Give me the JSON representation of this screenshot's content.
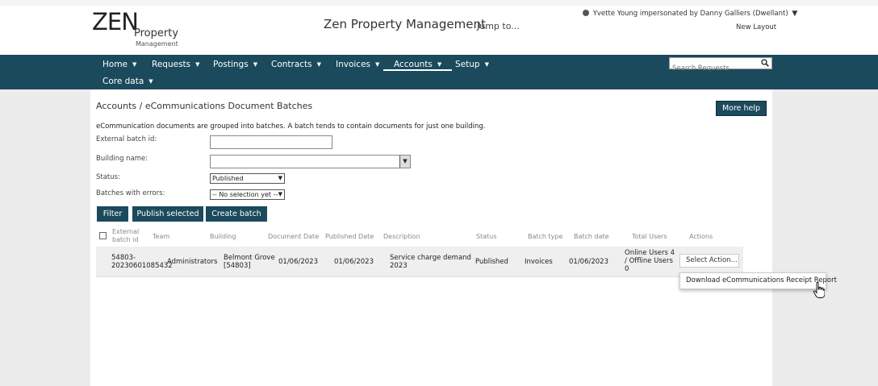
{
  "header": {
    "logo_zen": "ZEN",
    "logo_property": "Property",
    "logo_management": "Management",
    "app_title": "Zen Property Management",
    "jump_to": "Jump to...",
    "user_text": "Yvette Young impersonated by Danny Galliers (Dwellant)",
    "user_caret": "▼",
    "new_layout": "New Layout"
  },
  "nav": {
    "items": [
      {
        "label": "Home"
      },
      {
        "label": "Requests"
      },
      {
        "label": "Postings"
      },
      {
        "label": "Contracts"
      },
      {
        "label": "Invoices"
      },
      {
        "label": "Accounts",
        "active": true
      },
      {
        "label": "Setup"
      },
      {
        "label": "Core data"
      }
    ],
    "caret": "▼",
    "search_placeholder": "Search Requests"
  },
  "page": {
    "breadcrumb": "Accounts / eCommunications Document Batches",
    "more_help": "More help",
    "intro": "eCommunication documents are grouped into batches. A batch tends to contain documents for just one building."
  },
  "filters": {
    "external_batch_label": "External batch id:",
    "external_batch_value": "",
    "building_label": "Building name:",
    "building_value": "",
    "status_label": "Status:",
    "status_value": "Published",
    "errors_label": "Batches with errors:",
    "errors_value": "-- No selection yet --"
  },
  "buttons": {
    "filter": "Filter",
    "publish_selected": "Publish selected",
    "create_batch": "Create batch"
  },
  "table": {
    "headers": {
      "external_batch_id_1": "External",
      "external_batch_id_2": "batch id",
      "team": "Team",
      "building": "Building",
      "document_date": "Document Date",
      "published_date": "Published Date",
      "description": "Description",
      "status": "Status",
      "batch_type": "Batch type",
      "batch_date": "Batch date",
      "total_users": "Total Users",
      "actions": "Actions"
    },
    "rows": [
      {
        "batch_id_1": "54803-",
        "batch_id_2": "20230601085432",
        "team": "Administrators",
        "building_1": "Belmont Grove",
        "building_2": "[54803]",
        "document_date": "01/06/2023",
        "published_date": "01/06/2023",
        "description_1": "Service charge demand",
        "description_2": "2023",
        "status": "Published",
        "batch_type": "Invoices",
        "batch_date": "01/06/2023",
        "users_1": "Online Users 4",
        "users_2": "/ Offline Users",
        "users_3": "0",
        "action_label": "Select Action..."
      }
    ]
  },
  "dropdown": {
    "item": "Download eCommunications Receipt Report"
  },
  "colors": {
    "nav_bg": "#1b4a5c",
    "button_bg": "#1b4a5c",
    "page_bg": "#e9e9e9"
  },
  "icons": [
    "user-icon",
    "search-icon",
    "pointer-cursor-icon"
  ]
}
